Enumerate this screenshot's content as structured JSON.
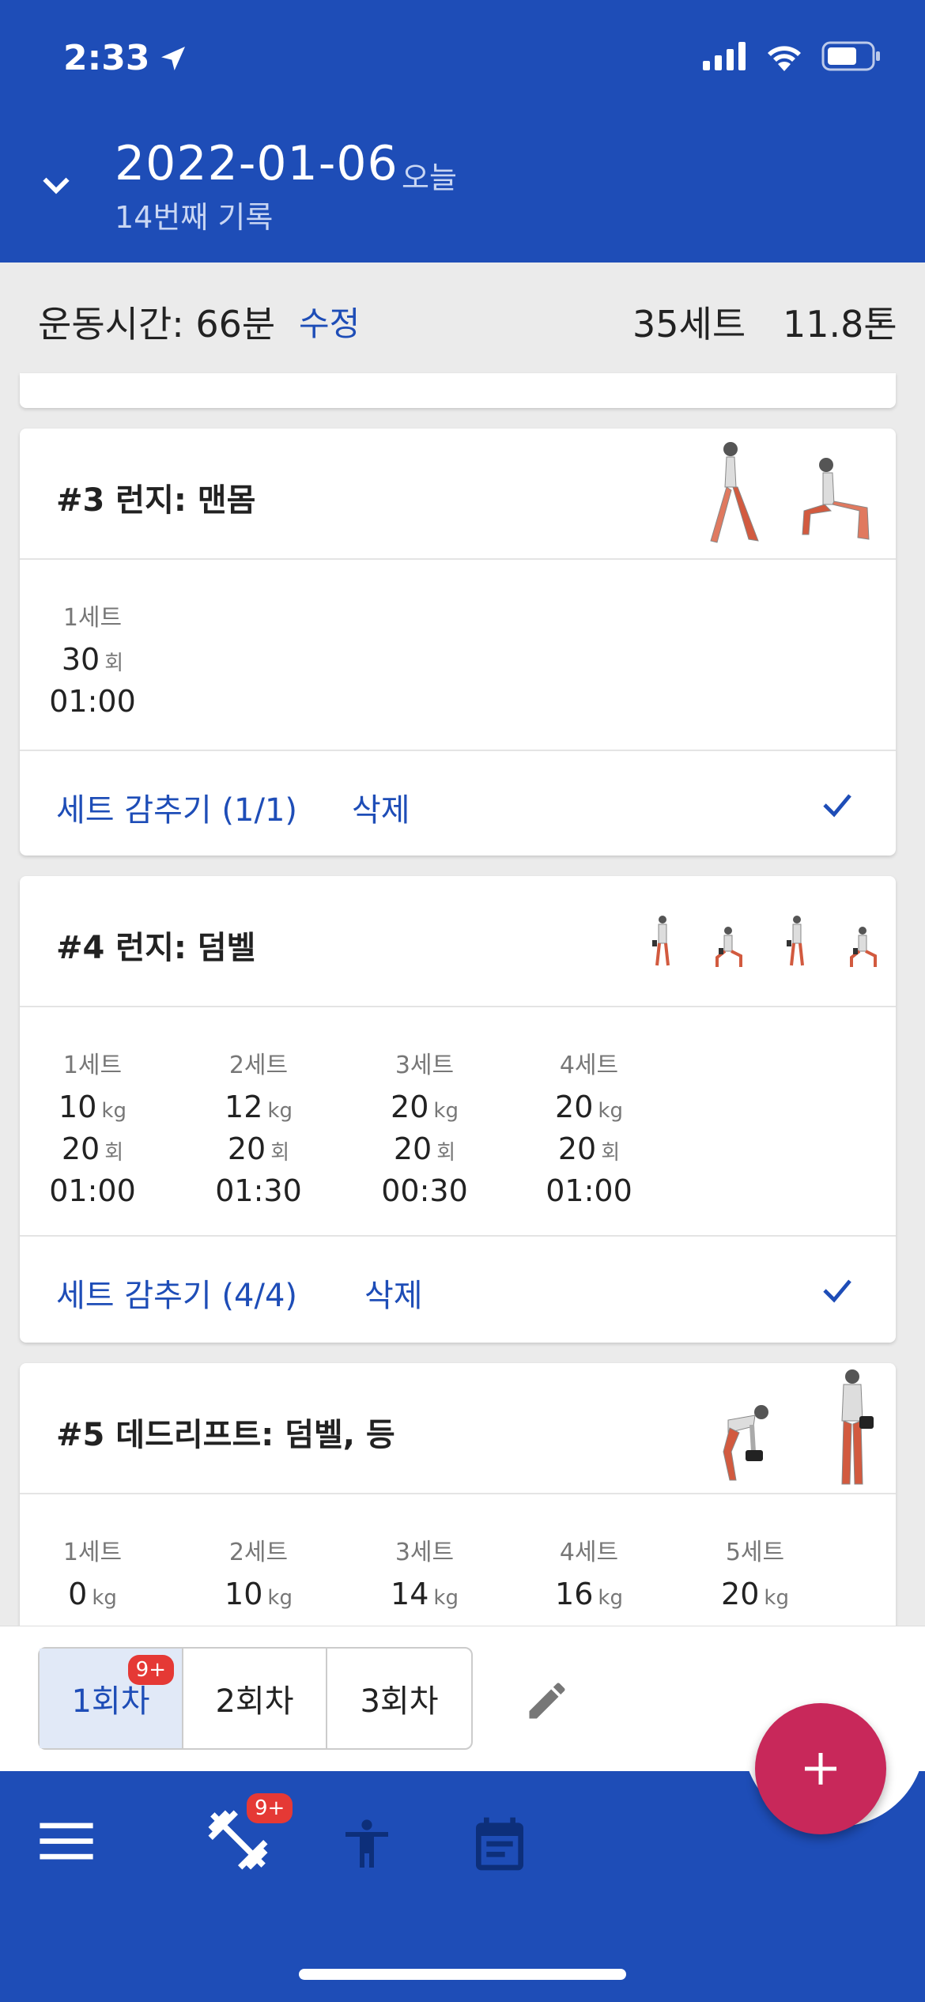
{
  "status": {
    "time": "2:33"
  },
  "header": {
    "date": "2022-01-06",
    "today": "오늘",
    "record": "14번째 기록"
  },
  "summary": {
    "time": "운동시간: 66분",
    "edit": "수정",
    "sets": "35세트",
    "tons": "11.8톤"
  },
  "exercises": [
    {
      "title": "#3 런지: 맨몸",
      "sets": [
        {
          "label": "1세트",
          "reps": "30",
          "reps_unit": "회",
          "time": "01:00"
        }
      ],
      "hide": "세트 감추기 (1/1)",
      "delete": "삭제"
    },
    {
      "title": "#4 런지: 덤벨",
      "sets": [
        {
          "label": "1세트",
          "weight": "10",
          "weight_unit": "kg",
          "reps": "20",
          "reps_unit": "회",
          "time": "01:00"
        },
        {
          "label": "2세트",
          "weight": "12",
          "weight_unit": "kg",
          "reps": "20",
          "reps_unit": "회",
          "time": "01:30"
        },
        {
          "label": "3세트",
          "weight": "20",
          "weight_unit": "kg",
          "reps": "20",
          "reps_unit": "회",
          "time": "00:30"
        },
        {
          "label": "4세트",
          "weight": "20",
          "weight_unit": "kg",
          "reps": "20",
          "reps_unit": "회",
          "time": "01:00"
        }
      ],
      "hide": "세트 감추기 (4/4)",
      "delete": "삭제"
    },
    {
      "title": "#5 데드리프트: 덤벨, 등",
      "sets": [
        {
          "label": "1세트",
          "weight": "0",
          "weight_unit": "kg"
        },
        {
          "label": "2세트",
          "weight": "10",
          "weight_unit": "kg"
        },
        {
          "label": "3세트",
          "weight": "14",
          "weight_unit": "kg"
        },
        {
          "label": "4세트",
          "weight": "16",
          "weight_unit": "kg"
        },
        {
          "label": "5세트",
          "weight": "20",
          "weight_unit": "kg"
        }
      ]
    }
  ],
  "sessions": [
    "1회차",
    "2회차",
    "3회차"
  ],
  "badges": {
    "session": "9+",
    "nav": "9+"
  },
  "colors": {
    "primary": "#1e4db7",
    "fab": "#c8285a",
    "badge": "#e53935"
  },
  "icons": [
    "chevron-down-icon",
    "menu-icon",
    "dumbbell-icon",
    "body-icon",
    "calendar-icon",
    "pencil-icon",
    "plus-icon",
    "check-icon"
  ]
}
